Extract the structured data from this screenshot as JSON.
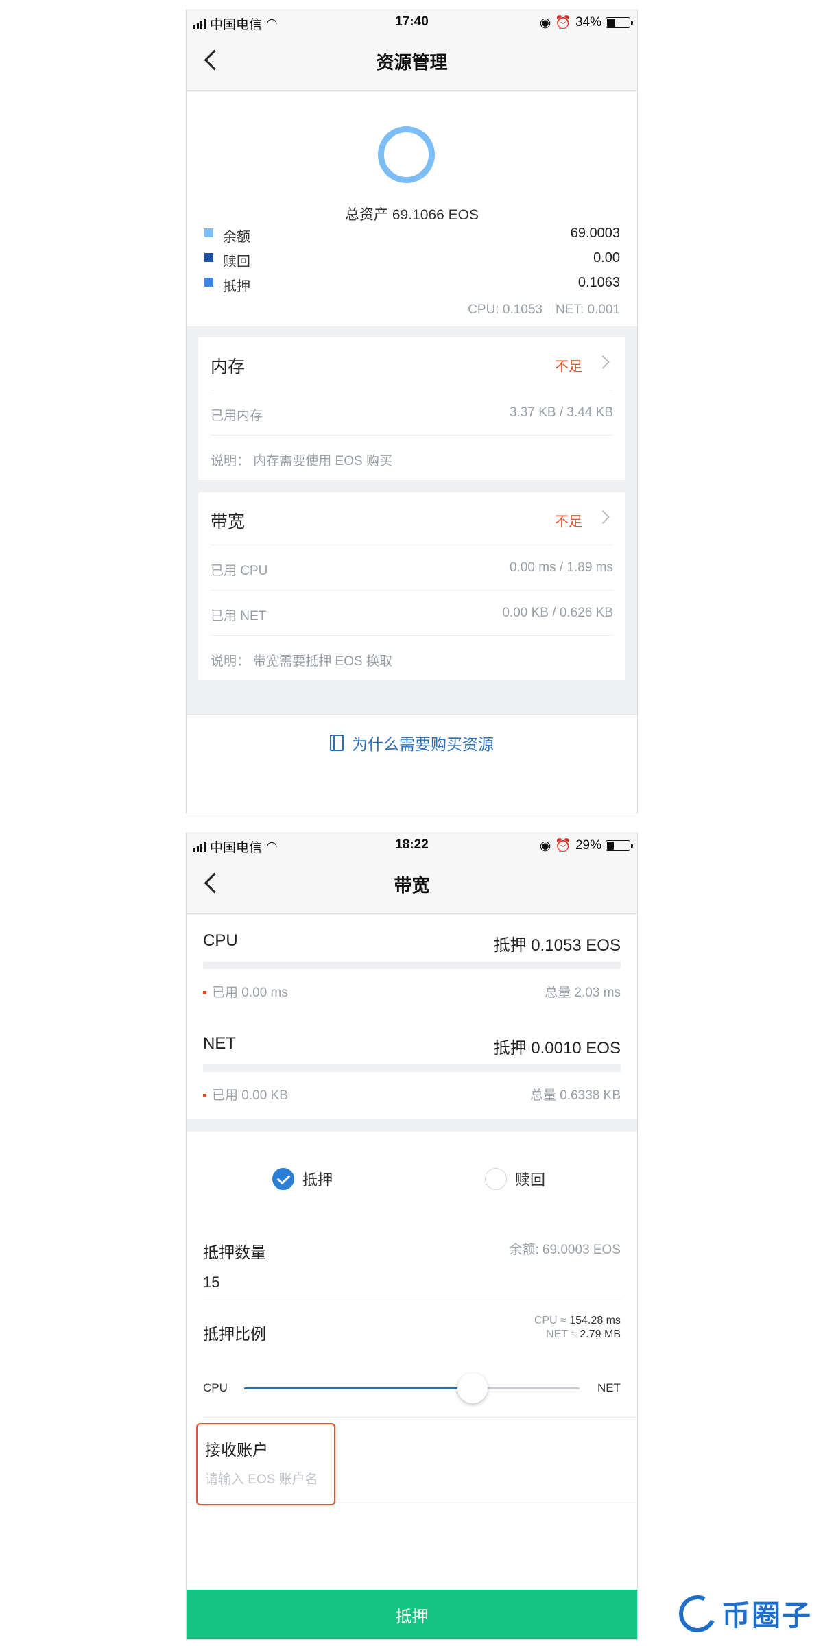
{
  "screen1": {
    "status": {
      "carrier": "中国电信",
      "time": "17:40",
      "battery": "34%",
      "battery_level": 0.34
    },
    "nav": {
      "title": "资源管理"
    },
    "total": "总资产 69.1066 EOS",
    "legend": [
      {
        "label": "余额",
        "value": "69.0003",
        "color": "#7dbdf5"
      },
      {
        "label": "赎回",
        "value": "0.00",
        "color": "#1d4fa3"
      },
      {
        "label": "抵押",
        "value": "0.1063",
        "color": "#3c86e8"
      }
    ],
    "stake_detail": "CPU: 0.1053｜NET: 0.001",
    "memory": {
      "title": "内存",
      "status": "不足",
      "used_label": "已用内存",
      "used_value": "3.37 KB / 3.44 KB",
      "note": "说明： 内存需要使用 EOS 购买"
    },
    "bandwidth": {
      "title": "带宽",
      "status": "不足",
      "cpu_label": "已用 CPU",
      "cpu_value": "0.00 ms / 1.89 ms",
      "net_label": "已用 NET",
      "net_value": "0.00 KB / 0.626 KB",
      "note": "说明： 带宽需要抵押 EOS 换取"
    },
    "why_link": "为什么需要购买资源"
  },
  "screen2": {
    "status": {
      "carrier": "中国电信",
      "time": "18:22",
      "battery": "29%",
      "battery_level": 0.29
    },
    "nav": {
      "title": "带宽"
    },
    "cpu": {
      "name": "CPU",
      "stake": "抵押 0.1053 EOS",
      "used": "已用 0.00 ms",
      "total": "总量 2.03 ms",
      "usage_fraction": 0.0
    },
    "net": {
      "name": "NET",
      "stake": "抵押 0.0010 EOS",
      "used": "已用 0.00 KB",
      "total": "总量 0.6338 KB",
      "usage_fraction": 0.0
    },
    "options": {
      "stake": "抵押",
      "redeem": "赎回",
      "selected": "stake"
    },
    "stake_amount": {
      "label": "抵押数量",
      "balance": "余额: 69.0003 EOS",
      "value": "15"
    },
    "ratio": {
      "label": "抵押比例",
      "cpu_prefix": "CPU ≈",
      "cpu_est": "154.28 ms",
      "net_prefix": "NET ≈",
      "net_est": "2.79 MB",
      "slider_left": "CPU",
      "slider_right": "NET",
      "slider_value": 0.68
    },
    "receiver": {
      "label": "接收账户",
      "placeholder": "请输入 EOS 账户名",
      "value": ""
    },
    "submit": "抵押"
  },
  "watermark": {
    "text": "币圈子"
  }
}
